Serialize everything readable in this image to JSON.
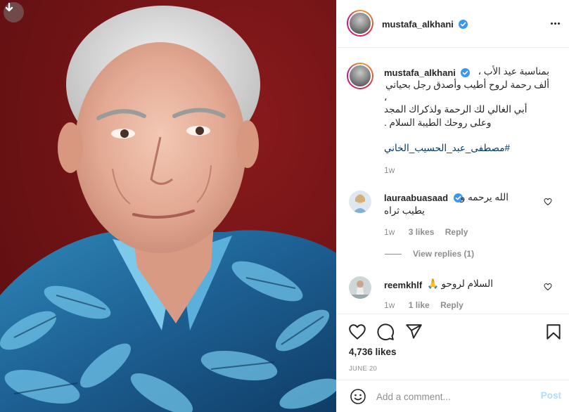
{
  "post": {
    "author": "mustafa_alkhani",
    "caption_lines": [
      "بمناسبة عيد الأب ،",
      "ألف رحمة لروح أطيب وأصدق رجل بحياتي",
      "،",
      "أبي الغالي لك الرحمة ولذكراك المجد",
      "وعلى روحك الطيبة السلام ."
    ],
    "hashtag": "#مصطفى_عبد_الحسيب_الخاني",
    "caption_age": "1w",
    "likes": "4,736 likes",
    "date": "JUNE 20"
  },
  "comments": [
    {
      "user": "laurаabuasaad",
      "text_line1": "الله يرحمه و",
      "text_line2": "يطيب ثراه",
      "age": "1w",
      "likes": "3 likes",
      "reply": "Reply",
      "view_replies": "View replies (1)"
    },
    {
      "user": "reemkhlf",
      "text": "السلام لروحو 🙏",
      "age": "1w",
      "likes": "1 like",
      "reply": "Reply"
    }
  ],
  "comment_box": {
    "placeholder": "Add a comment...",
    "post_label": "Post"
  },
  "colors": {
    "photo_background": "#6e1315",
    "verified": "#3897f0",
    "hashtag": "#00376b",
    "post_button": "#b3dbff",
    "meta_text": "#8e8e8e"
  },
  "icons": [
    "download-icon",
    "verified-icon",
    "more-icon",
    "heart-icon",
    "comment-icon",
    "share-icon",
    "bookmark-icon",
    "emoji-icon"
  ]
}
